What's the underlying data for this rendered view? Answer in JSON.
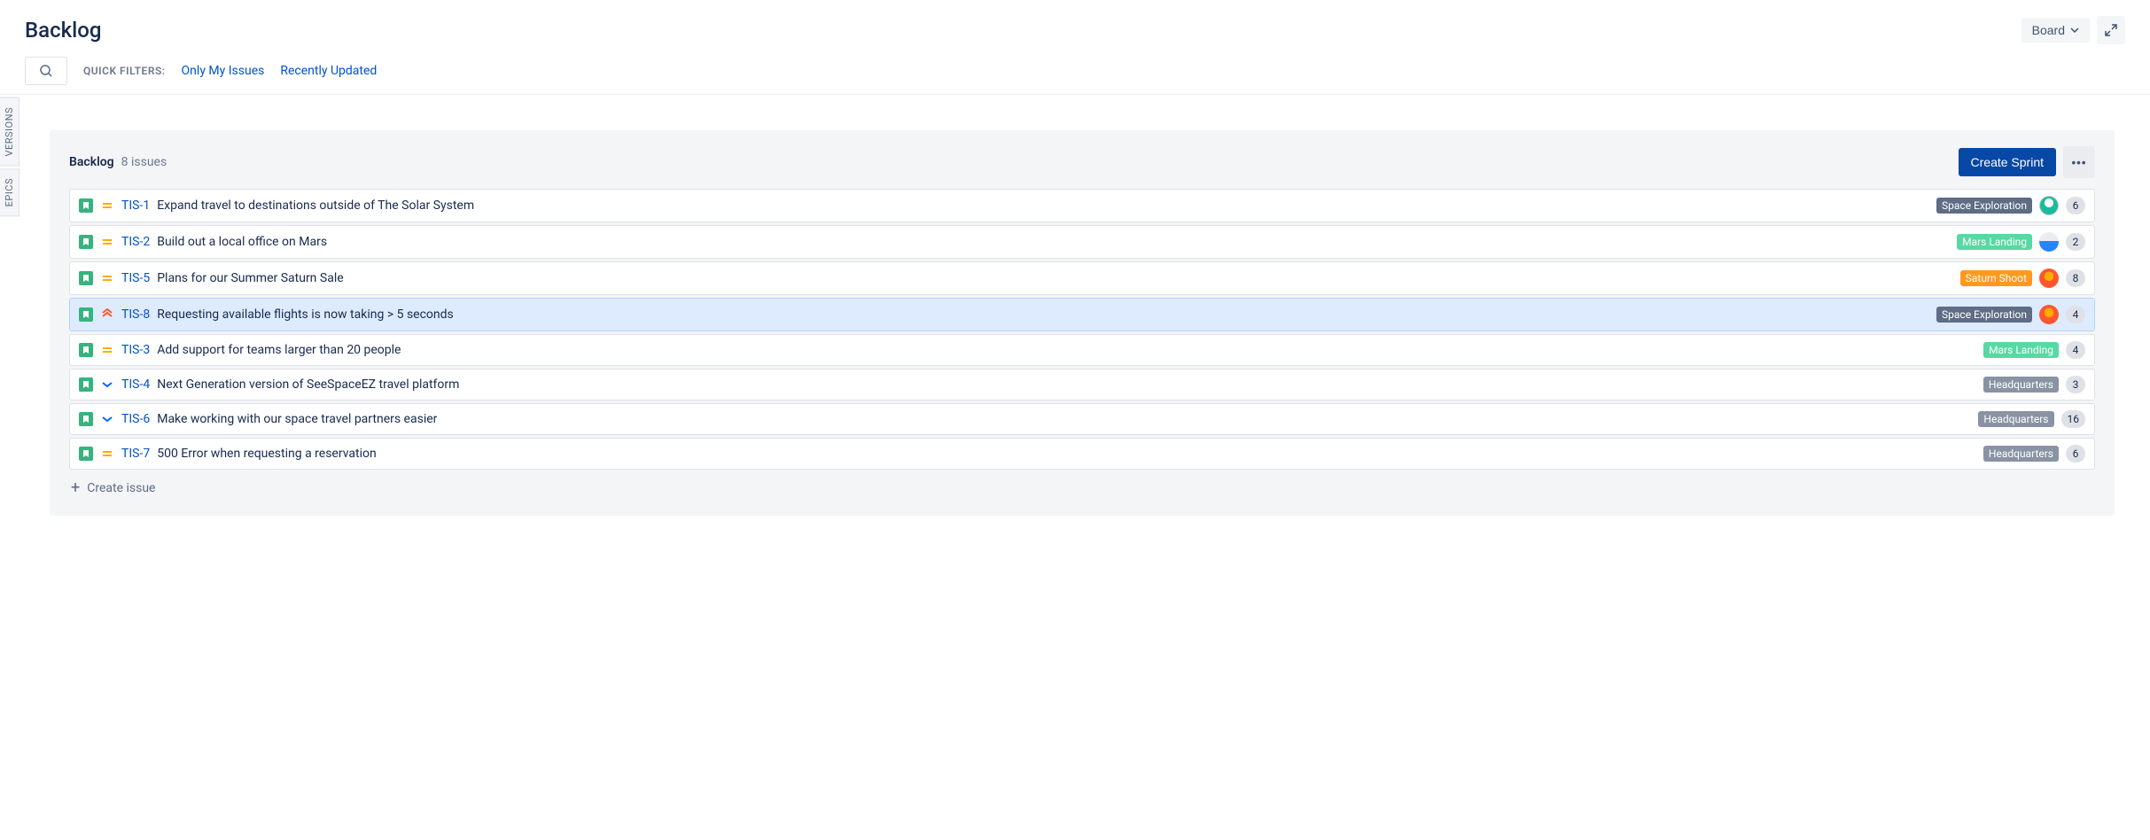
{
  "page_title": "Backlog",
  "header": {
    "board_button": "Board"
  },
  "filters": {
    "label": "QUICK FILTERS:",
    "only_my_issues": "Only My Issues",
    "recently_updated": "Recently Updated"
  },
  "side_tabs": {
    "versions": "VERSIONS",
    "epics": "EPICS"
  },
  "backlog": {
    "title": "Backlog",
    "count_text": "8 issues",
    "create_sprint": "Create Sprint",
    "create_issue": "Create issue",
    "issues": [
      {
        "key": "TIS-1",
        "summary": "Expand travel to destinations outside of The Solar System",
        "priority": "medium",
        "epic": "Space Exploration",
        "epic_color": "slate",
        "avatar": "a1",
        "estimate": "6",
        "selected": false
      },
      {
        "key": "TIS-2",
        "summary": "Build out a local office on Mars",
        "priority": "medium",
        "epic": "Mars Landing",
        "epic_color": "green",
        "avatar": "a2",
        "estimate": "2",
        "selected": false
      },
      {
        "key": "TIS-5",
        "summary": "Plans for our Summer Saturn Sale",
        "priority": "medium",
        "epic": "Saturn Shoot",
        "epic_color": "orange",
        "avatar": "a3",
        "estimate": "8",
        "selected": false
      },
      {
        "key": "TIS-8",
        "summary": "Requesting available flights is now taking > 5 seconds",
        "priority": "high",
        "epic": "Space Exploration",
        "epic_color": "slate",
        "avatar": "a3",
        "estimate": "4",
        "selected": true
      },
      {
        "key": "TIS-3",
        "summary": "Add support for teams larger than 20 people",
        "priority": "medium",
        "epic": "Mars Landing",
        "epic_color": "green",
        "avatar": null,
        "estimate": "4",
        "selected": false
      },
      {
        "key": "TIS-4",
        "summary": "Next Generation version of SeeSpaceEZ travel platform",
        "priority": "low",
        "epic": "Headquarters",
        "epic_color": "gray",
        "avatar": null,
        "estimate": "3",
        "selected": false
      },
      {
        "key": "TIS-6",
        "summary": "Make working with our space travel partners easier",
        "priority": "low",
        "epic": "Headquarters",
        "epic_color": "gray",
        "avatar": null,
        "estimate": "16",
        "selected": false
      },
      {
        "key": "TIS-7",
        "summary": "500 Error when requesting a reservation",
        "priority": "medium",
        "epic": "Headquarters",
        "epic_color": "gray",
        "avatar": null,
        "estimate": "6",
        "selected": false
      }
    ]
  }
}
